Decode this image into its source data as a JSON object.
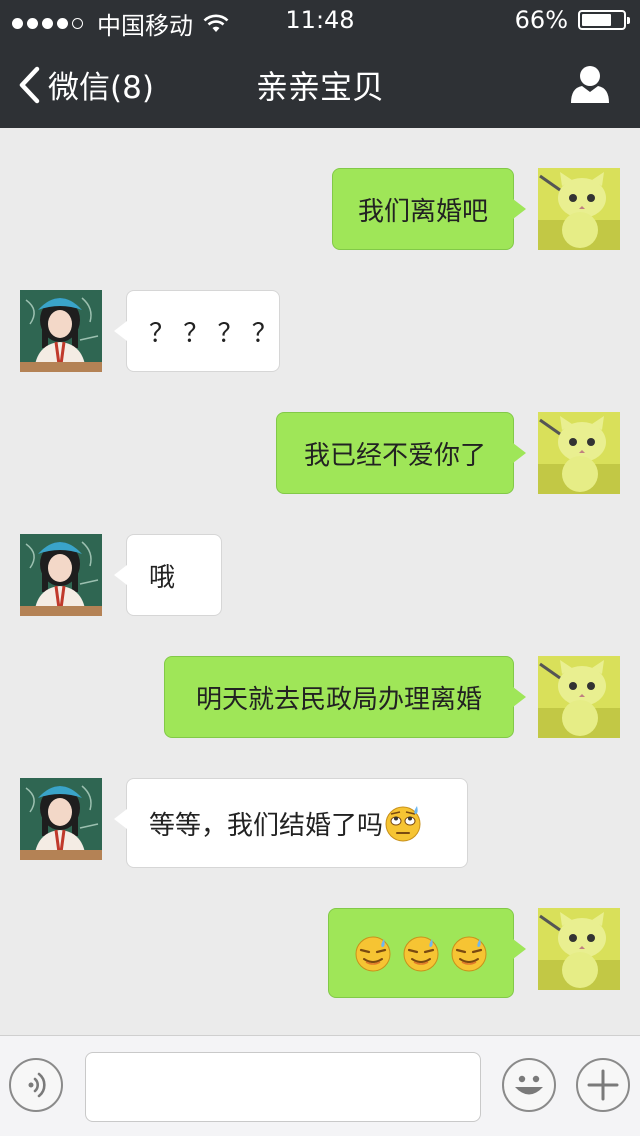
{
  "status_bar": {
    "carrier": "中国移动",
    "time": "11:48",
    "battery": "66%",
    "battery_level": 0.66,
    "signal_bars_filled": 4,
    "signal_bars_total": 5
  },
  "nav": {
    "back_label": "微信(8)",
    "title": "亲亲宝贝"
  },
  "messages": [
    {
      "sender": "self",
      "text": "我们离婚吧"
    },
    {
      "sender": "friend",
      "text": "？ ？ ？ ？"
    },
    {
      "sender": "self",
      "text": "我已经不爱你了"
    },
    {
      "sender": "friend",
      "text": "哦"
    },
    {
      "sender": "self",
      "text": "明天就去民政局办理离婚"
    },
    {
      "sender": "friend",
      "text": "等等，我们结婚了吗",
      "emoji": "sweat-roll-eyes-face"
    },
    {
      "sender": "self",
      "text": "",
      "emoji": "smug-sweat-face",
      "emoji_count": 3
    }
  ],
  "input_bar": {
    "input_value": "",
    "voice_icon": "voice-icon",
    "emoji_icon": "smiley-icon",
    "more_icon": "plus-icon"
  },
  "colors": {
    "nav_bg": "#2e3135",
    "chat_bg": "#ebebeb",
    "self_bubble": "#9fe658",
    "friend_bubble": "#ffffff"
  }
}
